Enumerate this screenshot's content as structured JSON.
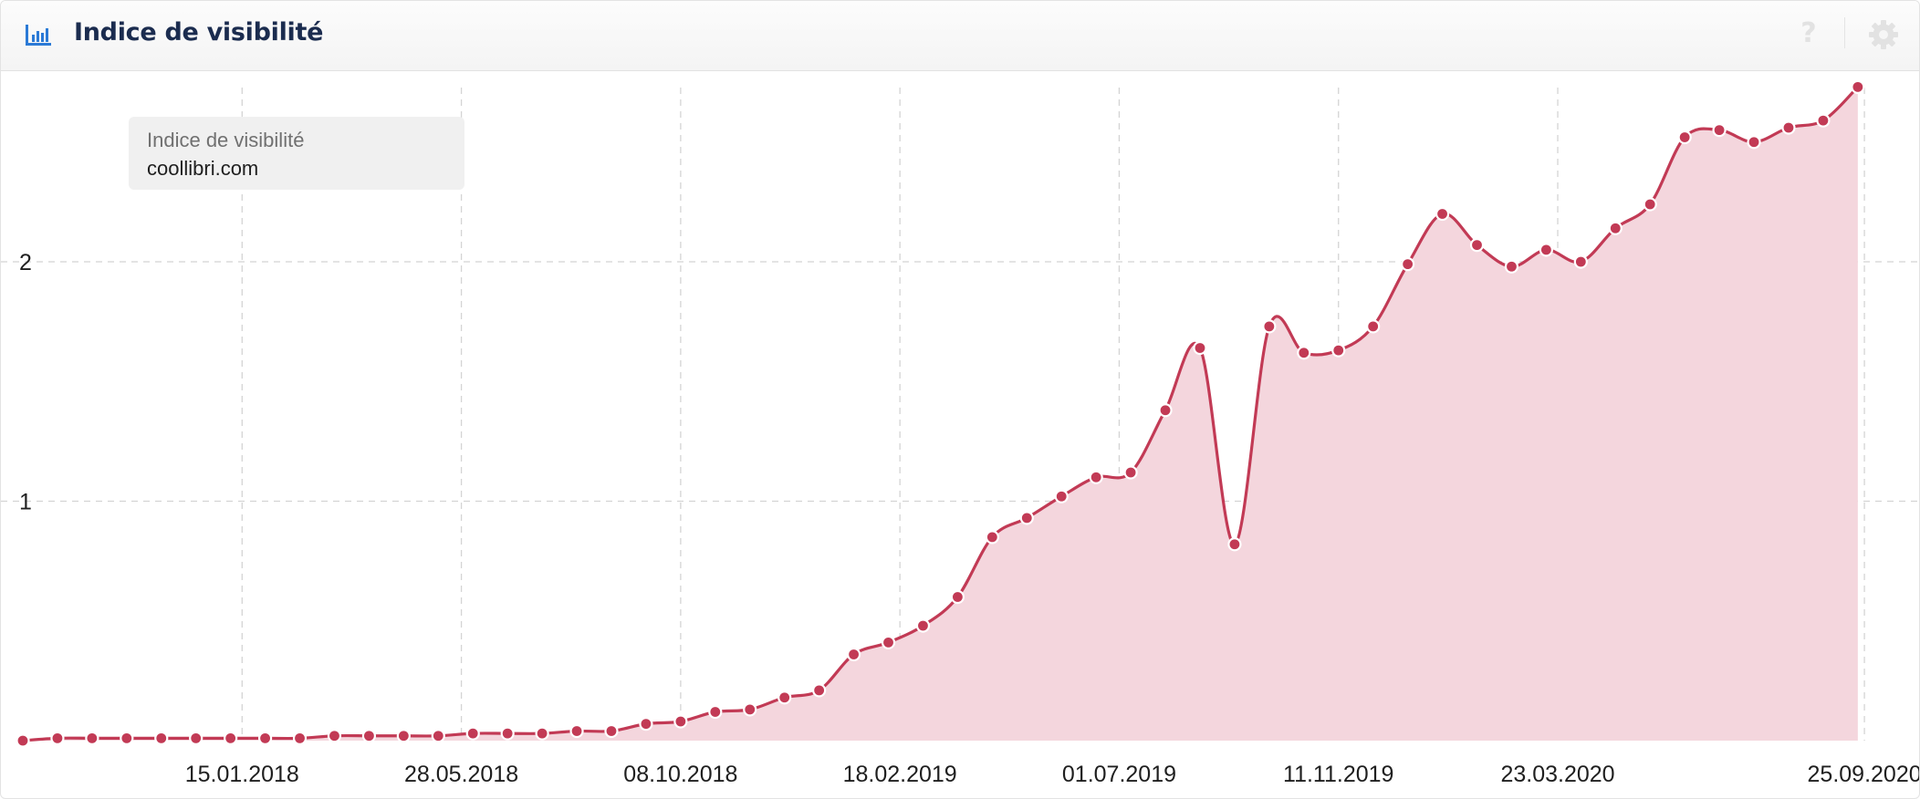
{
  "header": {
    "title": "Indice de visibilité"
  },
  "tooltip": {
    "title": "Indice de visibilité",
    "value": "coollibri.com"
  },
  "colors": {
    "line": "#c23a55",
    "fill": "#f4d6dd",
    "grid": "#d4d4d4",
    "accent": "#2b7ad6"
  },
  "icons": [
    "bar-chart-icon",
    "help-icon",
    "gear-icon"
  ],
  "chart_data": {
    "type": "area",
    "title": "Indice de visibilité",
    "series": [
      {
        "name": "coollibri.com",
        "dates": [
          "2017-09-04",
          "2017-09-25",
          "2017-10-16",
          "2017-11-06",
          "2017-11-27",
          "2017-12-18",
          "2018-01-08",
          "2018-01-29",
          "2018-02-19",
          "2018-03-12",
          "2018-04-02",
          "2018-04-23",
          "2018-05-14",
          "2018-06-04",
          "2018-06-25",
          "2018-07-16",
          "2018-08-06",
          "2018-08-27",
          "2018-09-17",
          "2018-10-08",
          "2018-10-29",
          "2018-11-19",
          "2018-12-10",
          "2018-12-31",
          "2019-01-21",
          "2019-02-11",
          "2019-03-04",
          "2019-03-25",
          "2019-04-15",
          "2019-05-06",
          "2019-05-27",
          "2019-06-17",
          "2019-07-08",
          "2019-07-29",
          "2019-08-19",
          "2019-09-09",
          "2019-09-30",
          "2019-10-21",
          "2019-11-11",
          "2019-12-02",
          "2019-12-23",
          "2020-01-13",
          "2020-02-03",
          "2020-02-24",
          "2020-03-16",
          "2020-04-06",
          "2020-04-27",
          "2020-05-18",
          "2020-06-08",
          "2020-06-29",
          "2020-07-20",
          "2020-08-10",
          "2020-08-31",
          "2020-09-21"
        ],
        "values": [
          0.0,
          0.01,
          0.01,
          0.01,
          0.01,
          0.01,
          0.01,
          0.01,
          0.01,
          0.02,
          0.02,
          0.02,
          0.02,
          0.03,
          0.03,
          0.03,
          0.04,
          0.04,
          0.07,
          0.08,
          0.12,
          0.13,
          0.18,
          0.21,
          0.36,
          0.41,
          0.48,
          0.6,
          0.85,
          0.93,
          1.02,
          1.1,
          1.12,
          1.38,
          1.64,
          0.82,
          1.73,
          1.62,
          1.63,
          1.73,
          1.99,
          2.2,
          2.07,
          1.98,
          2.05,
          2.0,
          2.14,
          2.24,
          2.52,
          2.55,
          2.5,
          2.56,
          2.59,
          2.73
        ]
      }
    ],
    "x_tick_labels": [
      "15.01.2018",
      "28.05.2018",
      "08.10.2018",
      "18.02.2019",
      "01.07.2019",
      "11.11.2019",
      "23.03.2020",
      "25.09.2020"
    ],
    "y_ticks": [
      1,
      2
    ],
    "ylim": [
      0,
      2.8
    ],
    "grid": true,
    "legend": "top-left"
  }
}
